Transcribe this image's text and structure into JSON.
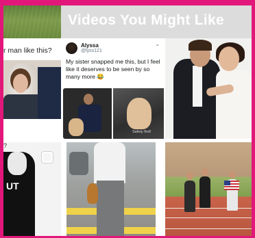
{
  "banner": {
    "title": "Videos You Might Like"
  },
  "tiles": {
    "top_left_caption": "r man like this?",
    "bottom_left_caption": "?",
    "bottom_left_shirt_text": "UT"
  },
  "tweet": {
    "name": "Alyssa",
    "handle": "@lyss121",
    "menu": "⌄",
    "text": "My sister snapped me this, but I feel like it deserves to be seen by so many more 😂",
    "image_caption": "Safety first!"
  },
  "colors": {
    "frame": "#e2177a",
    "banner_bg": "#d7d7d7",
    "banner_text": "#ffffff"
  }
}
